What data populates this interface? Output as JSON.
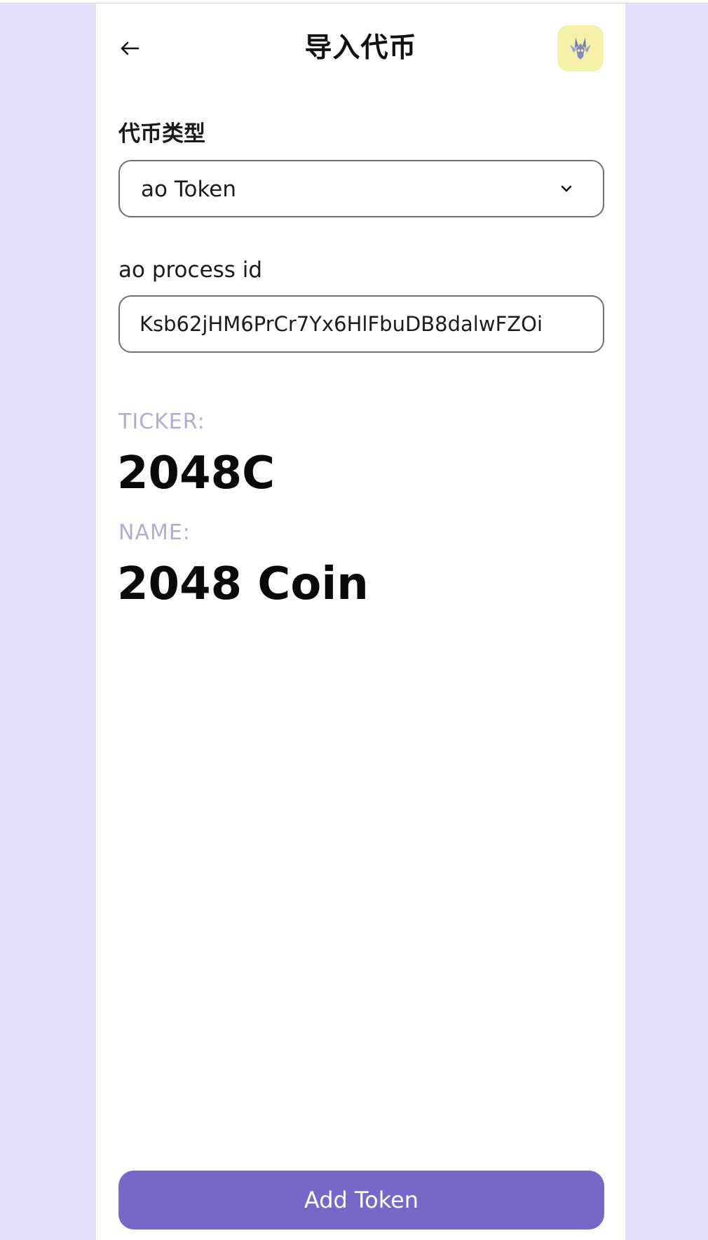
{
  "header": {
    "title": "导入代币",
    "back_icon": "arrow-left-icon",
    "avatar_icon": "wallet-avatar-icon",
    "avatar_color": "#f5f1a8"
  },
  "form": {
    "token_type_label": "代币类型",
    "token_type_value": "ao Token",
    "process_id_label": "ao process id",
    "process_id_value": "Ksb62jHM6PrCr7Yx6HlFbuDB8dalwFZOi"
  },
  "token_info": {
    "ticker_label": "TICKER:",
    "ticker_value": "2048C",
    "name_label": "NAME:",
    "name_value": "2048 Coin"
  },
  "actions": {
    "add_token_label": "Add Token",
    "accent_color": "#7767c9"
  },
  "colors": {
    "background": "#e4e0fc",
    "panel": "#ffffff",
    "muted_label": "#b0aecd"
  }
}
